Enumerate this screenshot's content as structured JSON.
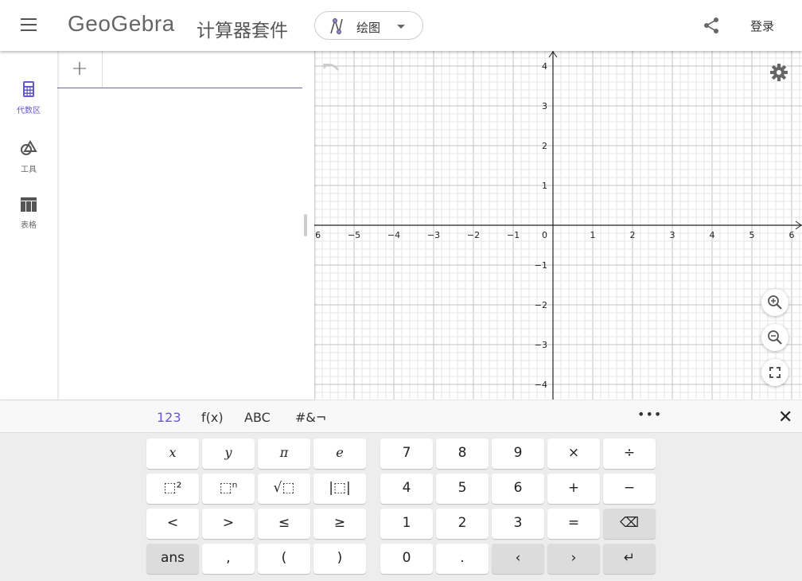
{
  "header": {
    "logo": "GeoGebra",
    "suite": "计算器套件",
    "app_selector": "绘图",
    "login": "登录"
  },
  "sidebar": {
    "items": [
      {
        "label": "代数区",
        "icon": "calculator-icon",
        "active": true
      },
      {
        "label": "工具",
        "icon": "tools-icon"
      },
      {
        "label": "表格",
        "icon": "table-icon"
      }
    ]
  },
  "algebra": {
    "add_label": "+",
    "input_value": ""
  },
  "graph": {
    "xmin": -6,
    "xmax": 6,
    "ymin": -4,
    "ymax": 4,
    "grid": true,
    "minor_divisions": 5,
    "origin_label": "0"
  },
  "keyboard": {
    "tabs": [
      "123",
      "f(x)",
      "ABC",
      "#&¬"
    ],
    "active_tab": "123",
    "more": "•••",
    "close": "✕",
    "left_keys": [
      [
        "x",
        "y",
        "π",
        "e"
      ],
      [
        "⬚²",
        "⬚ⁿ",
        "√⬚",
        "|⬚|"
      ],
      [
        "<",
        ">",
        "≤",
        "≥"
      ],
      [
        "ans",
        ",",
        "(",
        ")"
      ]
    ],
    "right_keys": [
      [
        "7",
        "8",
        "9",
        "×",
        "÷"
      ],
      [
        "4",
        "5",
        "6",
        "+",
        "−"
      ],
      [
        "1",
        "2",
        "3",
        "=",
        "⌫"
      ],
      [
        "0",
        ".",
        "‹",
        "›",
        "↵"
      ]
    ]
  },
  "colors": {
    "accent": "#6557d2",
    "grid_major": "#c0c0c0",
    "grid_minor": "#e6e6e6"
  }
}
